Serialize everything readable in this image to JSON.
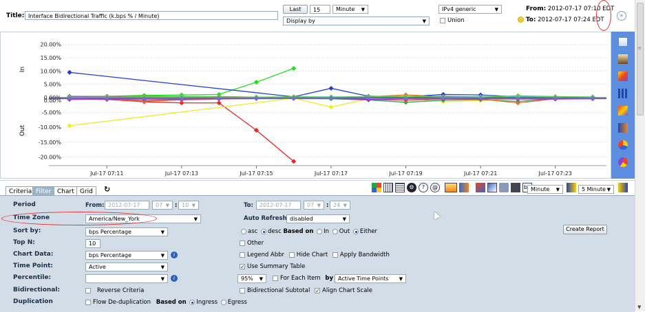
{
  "header": {
    "title_label": "Title:",
    "title_value": "Interface Bidirectional Traffic (k.bps % / Minute)",
    "last_button": "Last",
    "last_value": "15",
    "unit_select": "Minute",
    "display_by": "Display by",
    "ip_select": "IPv4 generic",
    "union_label": "Union",
    "from_label": "From:",
    "from_value": "2012-07-17 07:10 EDT",
    "to_label": "To:",
    "to_value": "2012-07-17 07:24 EDT"
  },
  "colors": {
    "accent": "#5c8fe0",
    "panel": "#d2dde7",
    "highlight": "#e03030"
  },
  "chart_data": {
    "type": "line",
    "x": [
      "07:10",
      "07:11",
      "07:12",
      "07:13",
      "07:14",
      "07:15",
      "07:16",
      "07:17",
      "07:18",
      "07:19",
      "07:20",
      "07:21",
      "07:22",
      "07:23",
      "07:24"
    ],
    "x_ticks": [
      "Jul-17 07:11",
      "Jul-17 07:13",
      "Jul-17 07:15",
      "Jul-17 07:17",
      "Jul-17 07:19",
      "Jul-17 07:21",
      "Jul-17 07:23"
    ],
    "in_axis_label": "In",
    "out_axis_label": "Out",
    "in_ticks": [
      "20.00%",
      "15.00%",
      "10.00%",
      "5.00%",
      "0.00%"
    ],
    "out_ticks": [
      "0.00%",
      "-5.00%",
      "-10.00%",
      "-15.00%",
      "-20.00%"
    ],
    "in_ylim": [
      0,
      22
    ],
    "out_ylim": [
      -22,
      0
    ],
    "in_series": [
      {
        "color": "#22dd22",
        "values": [
          0.5,
          0.5,
          0.8,
          1.0,
          1.2,
          5.8,
          11.0,
          null,
          null,
          null,
          null,
          null,
          null,
          null,
          null
        ]
      },
      {
        "color": "#1f3fd0",
        "values": [
          9.5,
          null,
          null,
          null,
          null,
          null,
          0.3,
          3.5,
          0.5,
          0.3,
          1.2,
          1.0,
          0.3,
          0.2,
          null
        ]
      },
      {
        "color": "#e07020",
        "values": [
          0.3,
          0.3,
          0.6,
          0.4,
          0.4,
          0.2,
          0.2,
          0.2,
          0.3,
          1.0,
          0.3,
          0.2,
          0.5,
          0.2,
          0.2
        ]
      },
      {
        "color": "#aa22cc",
        "values": [
          0.4,
          0.3,
          0.5,
          0.5,
          0.3,
          0.2,
          0.2,
          0.2,
          0.3,
          0.4,
          0.5,
          0.3,
          0.4,
          0.3,
          0.2
        ]
      },
      {
        "color": "#33dddd",
        "values": [
          0.2,
          0.2,
          0.2,
          0.2,
          0.2,
          0.2,
          0.3,
          0.3,
          0.3,
          0.3,
          0.3,
          0.3,
          0.3,
          0.3,
          0.3
        ]
      },
      {
        "color": "#66cc44",
        "values": [
          0.2,
          0.2,
          0.4,
          0.5,
          0.3,
          0.2,
          0.3,
          0.2,
          0.3,
          0.5,
          0.2,
          0.2,
          0.7,
          0.4,
          0.2
        ]
      }
    ],
    "out_series": [
      {
        "color": "#ee2222",
        "values": [
          -0.5,
          -0.6,
          -1.4,
          -1.8,
          -1.8,
          -11.0,
          -21.5,
          null,
          null,
          null,
          null,
          null,
          null,
          null,
          null
        ]
      },
      {
        "color": "#eeee22",
        "values": [
          -9.5,
          null,
          null,
          null,
          null,
          null,
          -0.2,
          -3.2,
          -0.4,
          -0.3,
          -1.4,
          -1.0,
          -0.3,
          -0.3,
          null
        ]
      },
      {
        "color": "#22aa55",
        "values": [
          -0.4,
          -0.4,
          -1.0,
          -0.6,
          -0.4,
          -0.3,
          -0.2,
          -0.4,
          -0.8,
          -1.6,
          -0.9,
          -0.7,
          -1.3,
          -0.4,
          -0.2
        ]
      },
      {
        "color": "#e07020",
        "values": [
          -0.3,
          -0.4,
          -1.2,
          -0.8,
          -0.5,
          -0.3,
          -0.2,
          -0.2,
          -0.6,
          -1.0,
          -0.5,
          -0.5,
          -1.8,
          -0.4,
          -0.2
        ]
      },
      {
        "color": "#aa22cc",
        "values": [
          -0.6,
          -0.5,
          -0.5,
          -0.5,
          -0.4,
          -0.3,
          -0.3,
          -0.3,
          -0.6,
          -0.5,
          -0.4,
          -0.4,
          -0.5,
          -0.5,
          -0.4
        ]
      },
      {
        "color": "#6677cc",
        "values": [
          -0.2,
          -0.2,
          -0.3,
          -0.3,
          -0.2,
          -0.2,
          -0.2,
          -0.2,
          -0.2,
          -0.3,
          -0.2,
          -0.2,
          -0.3,
          -0.2,
          -0.2
        ]
      }
    ]
  },
  "tabs": [
    {
      "label": "Criteria",
      "active": false
    },
    {
      "label": "Filter",
      "active": true
    },
    {
      "label": "Chart",
      "active": false
    },
    {
      "label": "Grid",
      "active": false
    }
  ],
  "toolbar": {
    "minute_select": "Minute",
    "interval_select": "5 Minute"
  },
  "filter": {
    "period_label": "Period",
    "from_label": "From:",
    "from_date": "2012-07-17",
    "from_hour": "07",
    "from_min": "10",
    "to_label": "To:",
    "to_date": "2012-07-17",
    "to_hour": "07",
    "to_min": "24",
    "timezone_label": "Time Zone",
    "timezone_value": "America/New_York",
    "auto_refresh_label": "Auto Refresh:",
    "auto_refresh_value": "disabled",
    "sortby_label": "Sort by:",
    "sortby_value": "bps Percentage",
    "asc": "asc",
    "desc": "desc",
    "based_on": "Based on",
    "in": "In",
    "out": "Out",
    "either": "Either",
    "create_report": "Create Report",
    "topn_label": "Top N:",
    "topn_value": "10",
    "other": "Other",
    "chartdata_label": "Chart Data:",
    "chartdata_value": "bps Percentage",
    "legend_abbr": "Legend Abbr",
    "hide_chart": "Hide Chart",
    "apply_bandwidth": "Apply Bandwidth",
    "timepoint_label": "Time Point:",
    "timepoint_value": "Active",
    "use_summary": "Use Summary Table",
    "percentile_label": "Percentile:",
    "percentile_value": "",
    "pct_select": "95%",
    "for_each_item": "For Each Item",
    "by": "by",
    "active_time_points": "Active Time Points",
    "bidir_label": "Bidirectional:",
    "reverse_criteria": "Reverse Criteria",
    "bidir_subtotal": "Bidirectional Subtotal",
    "align_chart_scale": "Align Chart Scale",
    "dup_label": "Duplication",
    "flow_dedup": "Flow De-duplication",
    "based_on2": "Based on",
    "ingress": "Ingress",
    "egress": "Egress"
  }
}
